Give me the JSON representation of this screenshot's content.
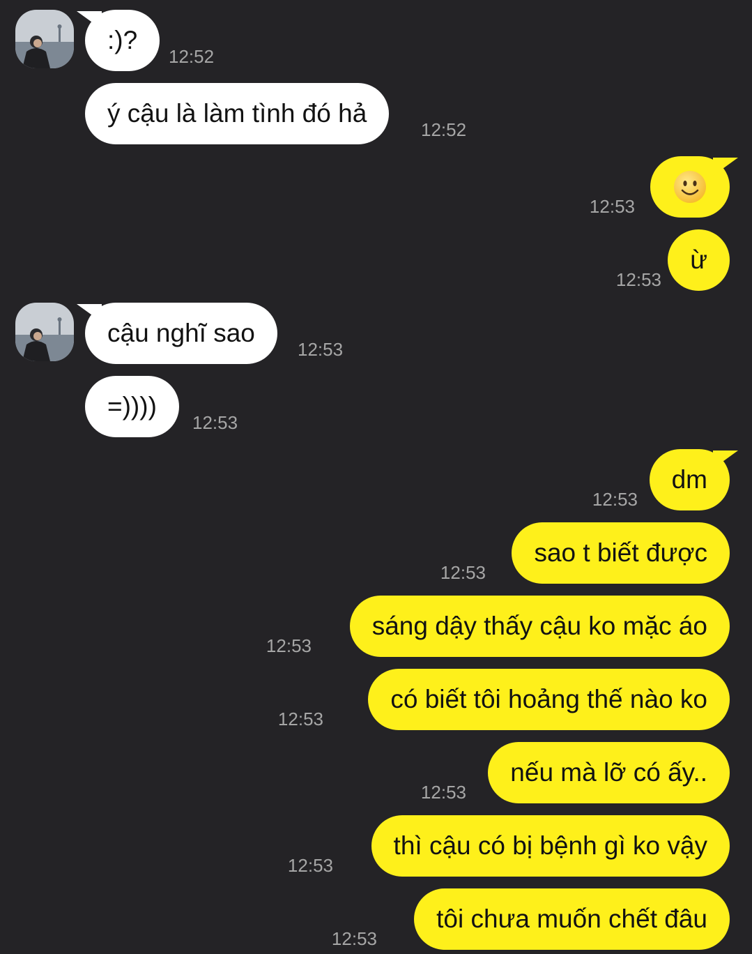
{
  "messages": [
    {
      "text": ":)?",
      "time": "12:52"
    },
    {
      "text": "ý cậu là làm tình đó hả",
      "time": "12:52"
    },
    {
      "text": "",
      "icon": "smiling-face-emoji",
      "time": "12:53"
    },
    {
      "text": "ừ",
      "time": "12:53"
    },
    {
      "text": "cậu nghĩ sao",
      "time": "12:53"
    },
    {
      "text": "=))))",
      "time": "12:53"
    },
    {
      "text": "dm",
      "time": "12:53"
    },
    {
      "text": "sao t biết được",
      "time": "12:53"
    },
    {
      "text": "sáng dậy thấy cậu ko mặc áo",
      "time": "12:53"
    },
    {
      "text": "có biết tôi hoảng thế nào ko",
      "time": "12:53"
    },
    {
      "text": "nếu mà lỡ có ấy..",
      "time": "12:53"
    },
    {
      "text": "thì cậu có bị bệnh gì ko vậy",
      "time": "12:53"
    },
    {
      "text": "tôi chưa muốn chết đâu",
      "time": "12:53"
    }
  ],
  "colors": {
    "background": "#242326",
    "incoming_bubble": "#ffffff",
    "outgoing_bubble": "#fef01b",
    "timestamp": "#a6a6a6"
  }
}
